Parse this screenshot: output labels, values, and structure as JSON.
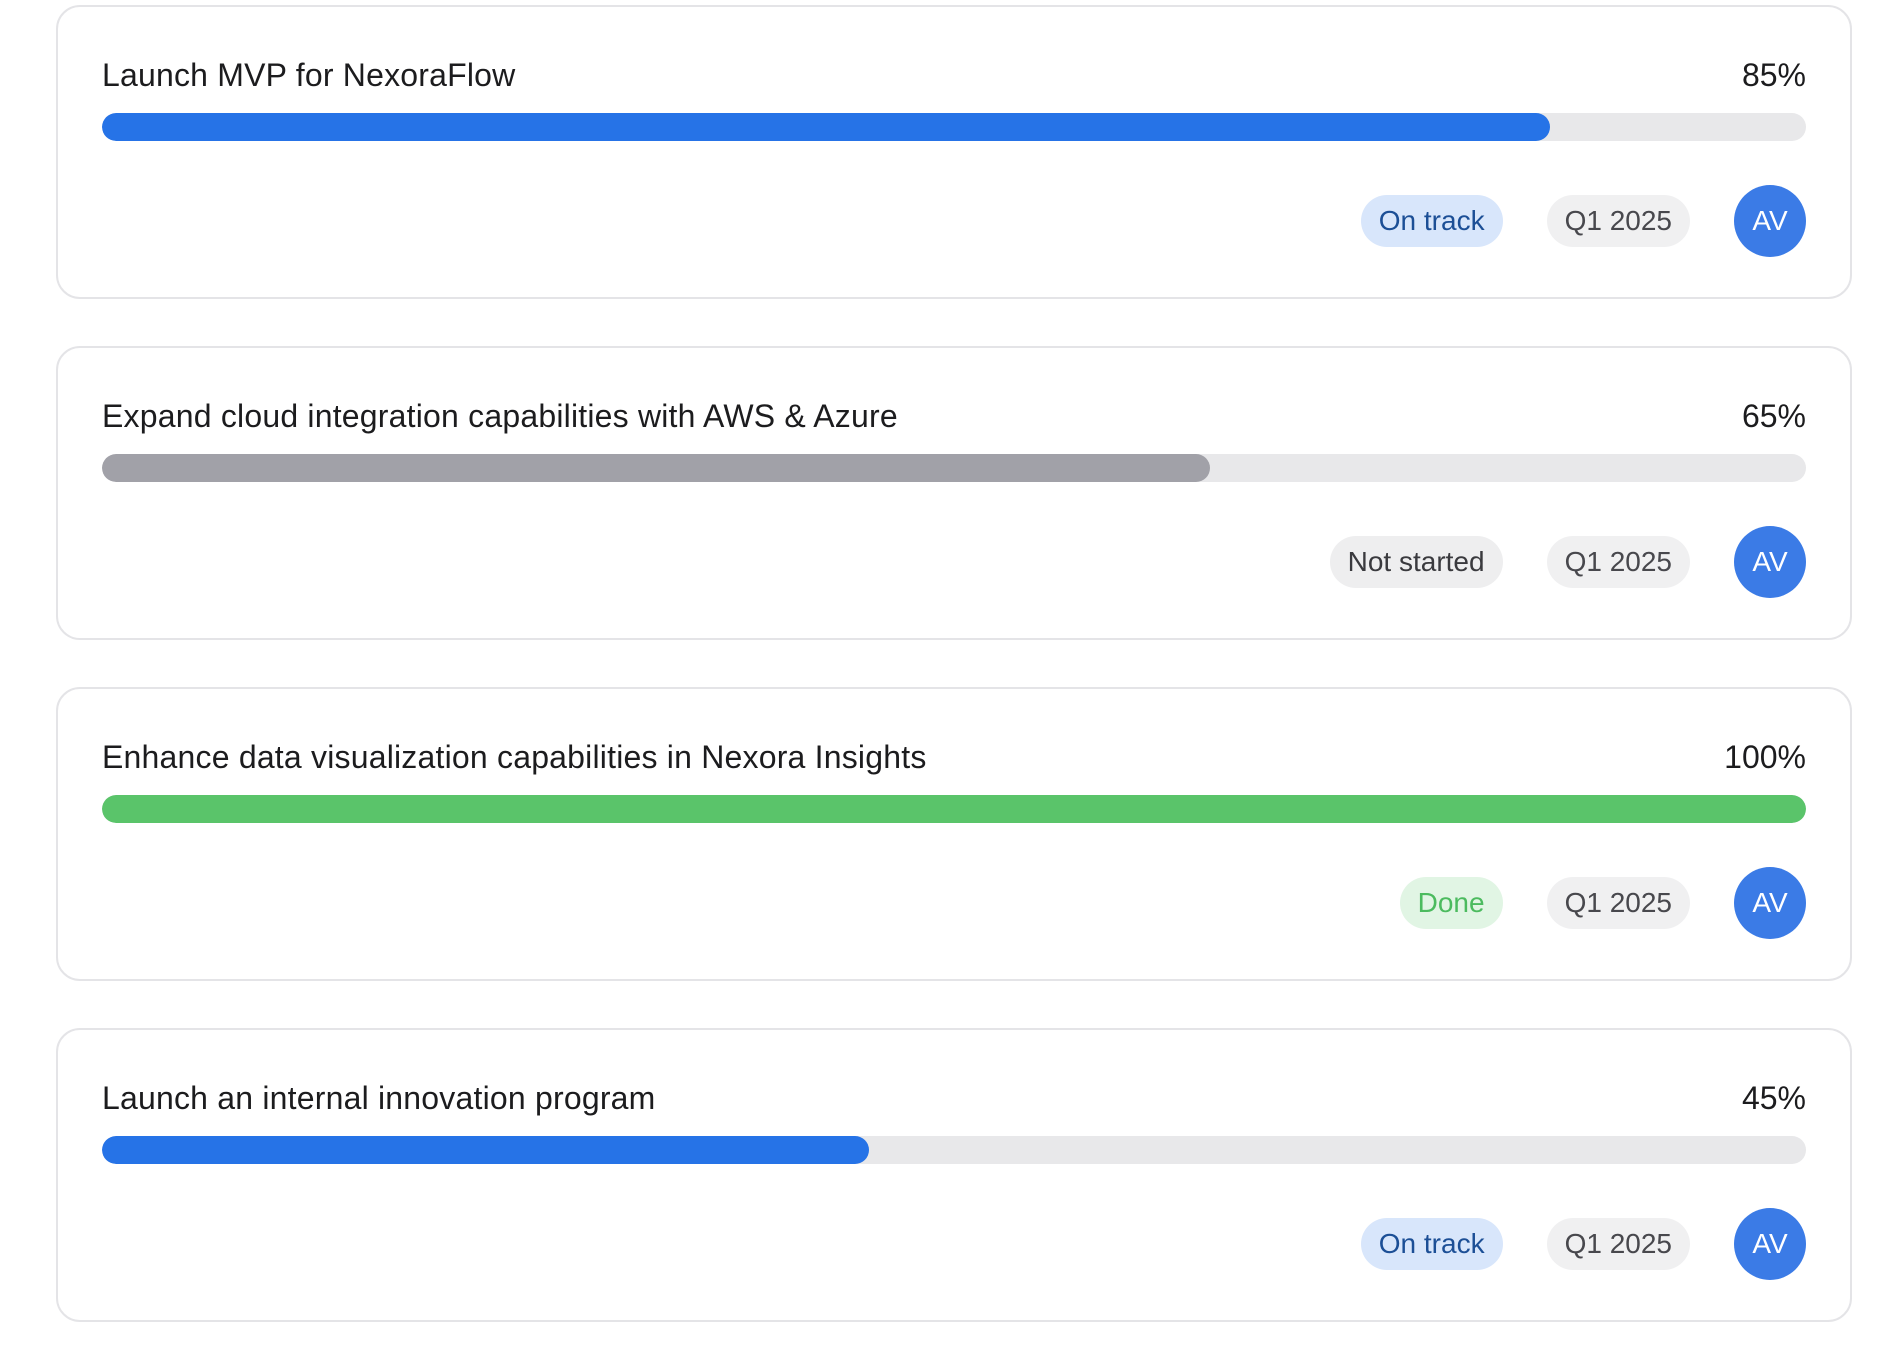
{
  "colors": {
    "on_track_fill": "#2673e7",
    "not_started_fill": "#a1a1a8",
    "done_fill": "#5ac46a",
    "on_track_badge_bg": "#d8e6fb",
    "on_track_badge_text": "#1c4f96",
    "not_started_badge_bg": "#eeeeef",
    "not_started_badge_text": "#3a3a3e",
    "done_badge_bg": "#e1f5e4",
    "done_badge_text": "#4cbb5f",
    "avatar_bg": "#3b7be6"
  },
  "goals": [
    {
      "title": "Launch MVP for NexoraFlow",
      "percent_label": "85%",
      "progress": 0.85,
      "status": "On track",
      "status_kind": "on_track",
      "quarter": "Q1 2025",
      "owner_initials": "AV"
    },
    {
      "title": "Expand cloud integration capabilities with AWS & Azure",
      "percent_label": "65%",
      "progress": 0.65,
      "status": "Not started",
      "status_kind": "not_started",
      "quarter": "Q1 2025",
      "owner_initials": "AV"
    },
    {
      "title": "Enhance data visualization capabilities in Nexora Insights",
      "percent_label": "100%",
      "progress": 1.0,
      "status": "Done",
      "status_kind": "done",
      "quarter": "Q1 2025",
      "owner_initials": "AV"
    },
    {
      "title": "Launch an internal innovation program",
      "percent_label": "45%",
      "progress": 0.45,
      "status": "On track",
      "status_kind": "on_track",
      "quarter": "Q1 2025",
      "owner_initials": "AV"
    }
  ]
}
